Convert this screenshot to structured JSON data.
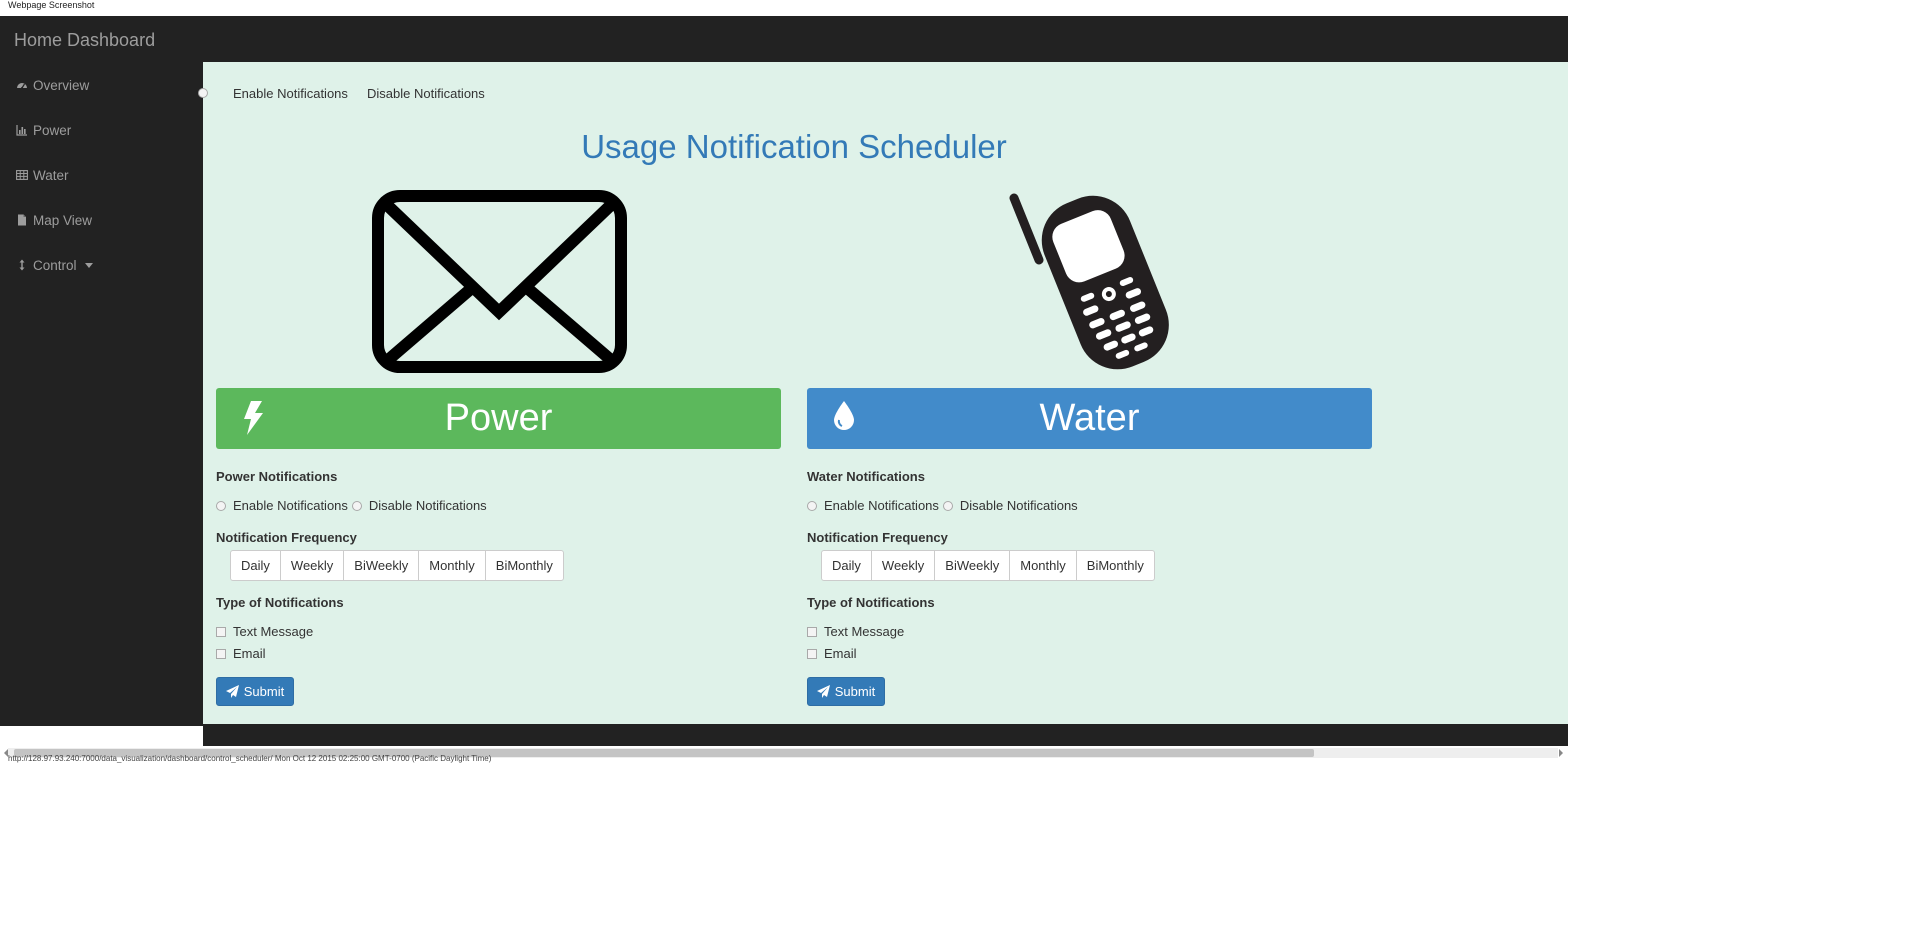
{
  "caption": "Webpage Screenshot",
  "navbar": {
    "brand": "Home Dashboard"
  },
  "sidebar": {
    "items": [
      {
        "label": "Overview",
        "icon": "dashboard-icon"
      },
      {
        "label": "Power",
        "icon": "bar-chart-icon"
      },
      {
        "label": "Water",
        "icon": "table-icon"
      },
      {
        "label": "Map View",
        "icon": "file-icon"
      },
      {
        "label": "Control",
        "icon": "resize-vertical-icon",
        "has_dropdown": true
      }
    ]
  },
  "top_options": {
    "enable": "Enable Notifications",
    "disable": "Disable Notifications"
  },
  "main": {
    "title": "Usage Notification Scheduler",
    "left_image": "envelope-icon",
    "right_image": "cell-phone-icon"
  },
  "power": {
    "banner": "Power",
    "banner_icon": "lightning-bolt-icon",
    "banner_color": "#5cb85c",
    "notifications_label": "Power Notifications",
    "enable": "Enable Notifications",
    "disable": "Disable Notifications",
    "frequency_label": "Notification Frequency",
    "frequencies": [
      "Daily",
      "Weekly",
      "BiWeekly",
      "Monthly",
      "BiMonthly"
    ],
    "type_label": "Type of Notifications",
    "types": [
      "Text Message",
      "Email"
    ],
    "submit": "Submit"
  },
  "water": {
    "banner": "Water",
    "banner_icon": "water-drop-icon",
    "banner_color": "#428bca",
    "notifications_label": "Water Notifications",
    "enable": "Enable Notifications",
    "disable": "Disable Notifications",
    "frequency_label": "Notification Frequency",
    "frequencies": [
      "Daily",
      "Weekly",
      "BiWeekly",
      "Monthly",
      "BiMonthly"
    ],
    "type_label": "Type of Notifications",
    "types": [
      "Text Message",
      "Email"
    ],
    "submit": "Submit"
  },
  "status_bar": {
    "text": "http://128.97.93.240:7000/data_visualization/dashboard/control_scheduler/ Mon Oct 12 2015 02:25:00 GMT-0700 (Pacific Daylight Time)"
  }
}
